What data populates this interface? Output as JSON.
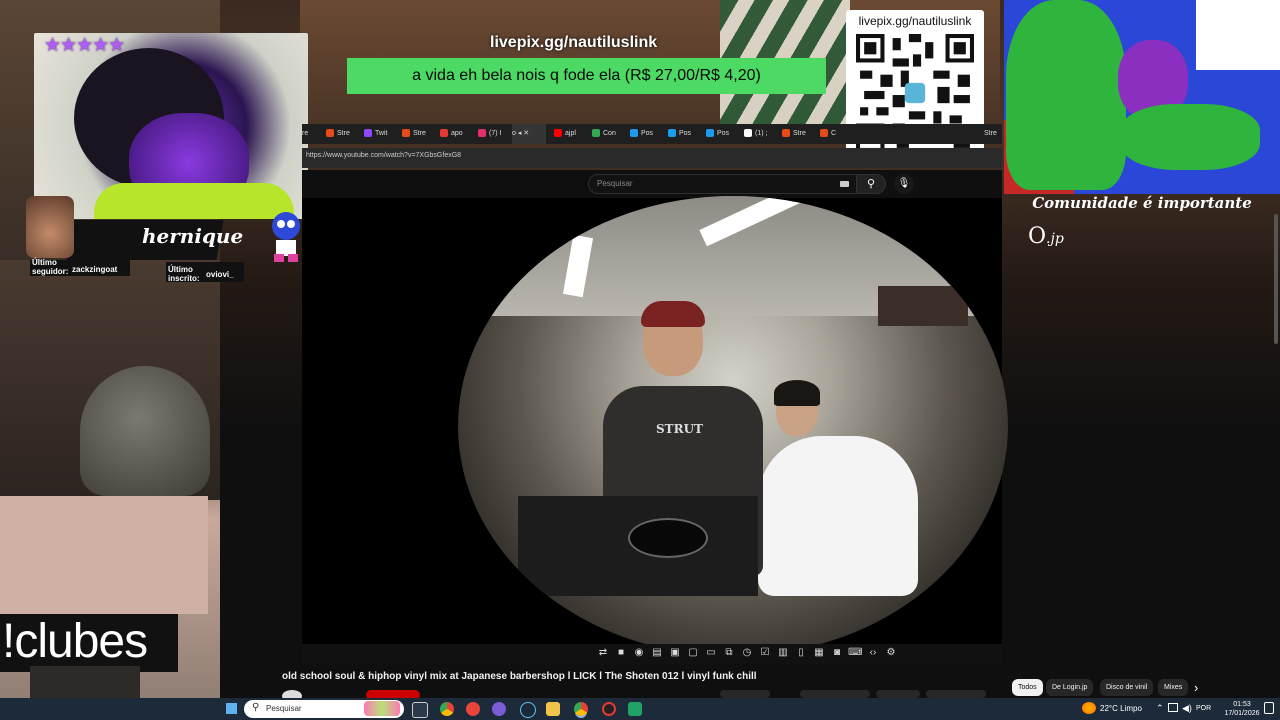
{
  "overlay": {
    "stars": "★★★★★",
    "streamer_name": "hernique",
    "last_follower_label": "Último seguidor:",
    "last_follower": "zackzingoat",
    "last_sub_label": "Último inscrito:",
    "last_sub": "oviovi_",
    "chat_command": "!clubes",
    "pix_url": "livepix.gg/nautiluslink",
    "pix_message": "a vida eh bela nois q fode ela (R$ 27,00/R$ 4,20)",
    "qr_label": "livepix.gg/nautiluslink",
    "art_caption": "Comunidade é importante",
    "logo_text": "O",
    "logo_suffix": ".jp"
  },
  "browser": {
    "tabs": [
      "re",
      "Stre",
      "Twit",
      "Stre",
      "apo",
      "(7) I",
      "o",
      "ajpl",
      "Con",
      "Pos",
      "Pos",
      "Pos",
      "(1) ;",
      "Stre",
      "C",
      "Stre"
    ],
    "url": "https://www.youtube.com/watch?v=7XGbsGfexG8",
    "search_placeholder": "Pesquisar"
  },
  "video": {
    "title": "old school soul & hiphop vinyl mix at Japanese barbershop l LICK l The Shoten 012 l vinyl funk chill",
    "shirt_text": "STRUT",
    "chips": [
      "Todos",
      "De Login.jp",
      "Disco de vinil",
      "Mixes"
    ],
    "chip_next": "›"
  },
  "taskbar": {
    "search_placeholder": "Pesquisar",
    "weather": "22°C  Limpo",
    "lang": "POR",
    "time": "01:53",
    "date": "17/01/2026"
  },
  "colors": {
    "pix_green": "#4cd964",
    "yt_bg": "#0f0f0f",
    "taskbar": "#1c2a3a"
  }
}
